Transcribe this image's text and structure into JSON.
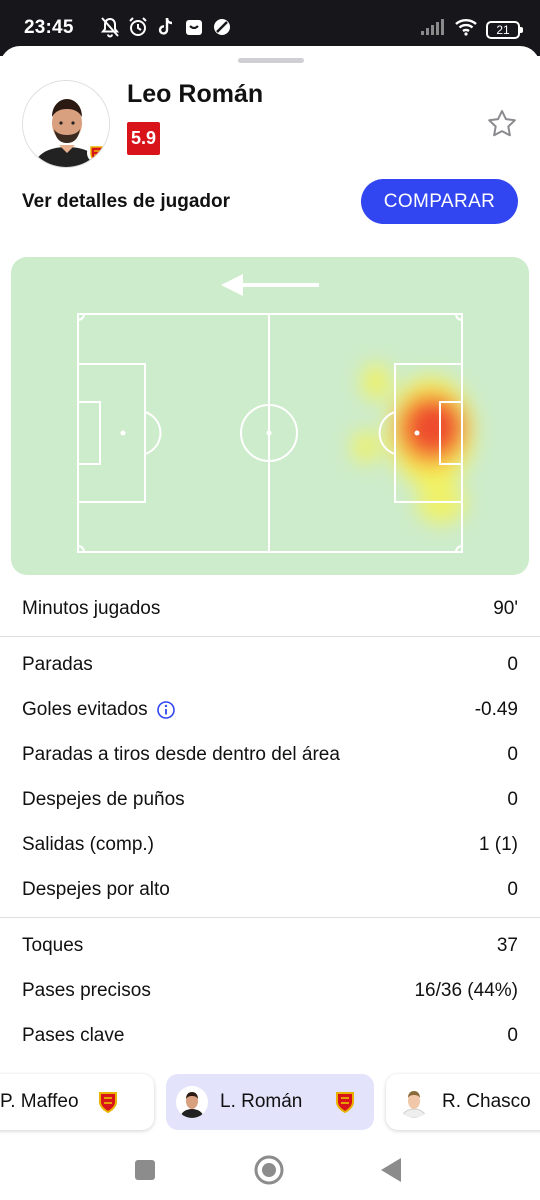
{
  "status_bar": {
    "time": "23:45",
    "notification_icons": [
      "mute-bell-icon",
      "alarm-icon",
      "tiktok-icon",
      "app-icon",
      "app-icon-2"
    ],
    "battery_level": "21"
  },
  "player": {
    "name": "Leo Román",
    "rating": "5.9",
    "rating_color": "#d8131a",
    "details_link": "Ver detalles de jugador",
    "compare_label": "COMPARAR"
  },
  "heatmap": {
    "attack_direction": "left",
    "pitch_color": "#cdeccb"
  },
  "stats": {
    "groups": [
      [
        {
          "label": "Minutos jugados",
          "value": "90'"
        }
      ],
      [
        {
          "label": "Paradas",
          "value": "0"
        },
        {
          "label": "Goles evitados",
          "value": "-0.49",
          "info": true
        },
        {
          "label": "Paradas a tiros desde dentro del área",
          "value": "0"
        },
        {
          "label": "Despejes de puños",
          "value": "0"
        },
        {
          "label": "Salidas (comp.)",
          "value": "1 (1)"
        },
        {
          "label": "Despejes por alto",
          "value": "0"
        }
      ],
      [
        {
          "label": "Toques",
          "value": "37"
        },
        {
          "label": "Pases precisos",
          "value": "16/36 (44%)"
        },
        {
          "label": "Pases clave",
          "value": "0"
        }
      ]
    ]
  },
  "carousel": {
    "players": [
      {
        "name": "P. Maffeo"
      },
      {
        "name": "L. Román"
      },
      {
        "name": "R. Chasco"
      }
    ]
  },
  "colors": {
    "accent": "#3146f0",
    "active_chip": "#e3e4fb"
  }
}
